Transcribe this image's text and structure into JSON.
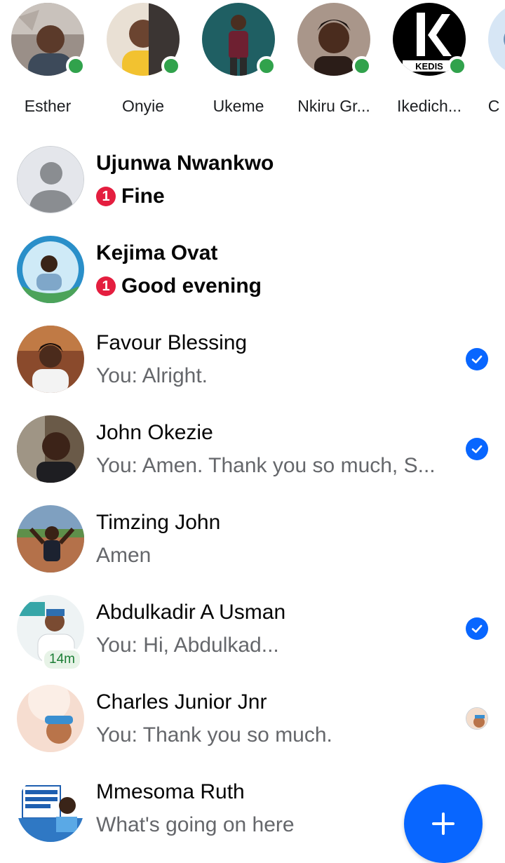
{
  "stories": [
    {
      "name": "Esther",
      "online": true,
      "icon": "avatar-esther"
    },
    {
      "name": "Onyie",
      "online": true,
      "icon": "avatar-onyie"
    },
    {
      "name": "Ukeme",
      "online": true,
      "icon": "avatar-ukeme"
    },
    {
      "name": "Nkiru Gr...",
      "online": true,
      "icon": "avatar-nkiru"
    },
    {
      "name": "Ikedich...",
      "online": true,
      "icon": "avatar-ikedisi",
      "logo_text": "KEDIS"
    },
    {
      "name": "C",
      "online": false,
      "icon": "avatar-partial"
    }
  ],
  "chats": [
    {
      "name": "Ujunwa Nwankwo",
      "message": "Fine",
      "unread_count": "1",
      "unread": true,
      "status": "none"
    },
    {
      "name": "Kejima Ovat",
      "message": "Good evening",
      "unread_count": "1",
      "unread": true,
      "status": "none"
    },
    {
      "name": "Favour Blessing",
      "message": "You: Alright.",
      "unread": false,
      "status": "sent-check"
    },
    {
      "name": "John Okezie",
      "message": "You: Amen. Thank you so much, S...",
      "unread": false,
      "status": "sent-check"
    },
    {
      "name": "Timzing John",
      "message": "Amen",
      "unread": false,
      "status": "none"
    },
    {
      "name": "Abdulkadir A Usman",
      "message": "You: Hi, Abdulkad...",
      "unread": false,
      "status": "sent-check",
      "active_ago": "14m"
    },
    {
      "name": "Charles Junior Jnr",
      "message": "You: Thank you so much.",
      "unread": false,
      "status": "seen-avatar"
    },
    {
      "name": "Mmesoma Ruth",
      "message": "What's going on here",
      "unread": false,
      "status": "none"
    }
  ],
  "fab": {
    "icon": "plus-icon"
  },
  "colors": {
    "accent": "#0866ff",
    "online": "#31a24c",
    "unread_badge": "#e41e3f",
    "secondary_text": "#65676b"
  }
}
